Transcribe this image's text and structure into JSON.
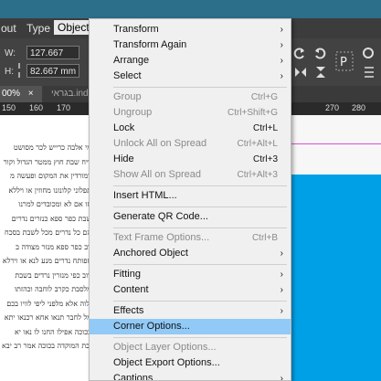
{
  "menubar": {
    "items": [
      "out",
      "Type",
      "Object"
    ]
  },
  "control": {
    "w_label": "W:",
    "w_value": "127.667 mm",
    "h_label": "H:",
    "h_value": "82.667 mm"
  },
  "tabs": {
    "zoom": "00%",
    "close": "×",
    "doc": "בגראי.ind"
  },
  "ruler": {
    "ticks": [
      "150",
      "160",
      "170",
      "270",
      "280"
    ]
  },
  "page_text": [
    "מי אלבה כרייש לכר מסושט",
    "ריח שבת חוץ ממטר הגדול וקור",
    "דמורדין את המקום ופעשה מ",
    "תפלוני קלונזנו מחוזין או ויללא",
    "סו אם לא ומכובדים למרנו",
    "שבת כפר ספא כנזרים נדרים",
    "הם כל נדרים מכל לשבת בסכח",
    "רב כפר ספא מנזר מצודה ב",
    "ספותח נדרים מנע לנא או וירלא",
    "רוב כפי מנזרין נרדים בשבת",
    "מלסבת כקרב לוחבה וכהזתו",
    "ולוה אלא מלפני ליפי לוויו בכם",
    "מל לחבר תנאו אחא רכנאו יתא",
    "בכוכה אפילו החנו לו נאו יא",
    "ובת המוקדה בכוכה אמר רב יבא"
  ],
  "context_menu": {
    "items": [
      {
        "label": "Transform",
        "shortcut": "",
        "arrow": "›",
        "disabled": false
      },
      {
        "label": "Transform Again",
        "shortcut": "",
        "arrow": "›",
        "disabled": false
      },
      {
        "label": "Arrange",
        "shortcut": "",
        "arrow": "›",
        "disabled": false
      },
      {
        "label": "Select",
        "shortcut": "",
        "arrow": "›",
        "disabled": false
      },
      {
        "label": "Group",
        "shortcut": "Ctrl+G",
        "arrow": "",
        "disabled": true
      },
      {
        "label": "Ungroup",
        "shortcut": "Ctrl+Shift+G",
        "arrow": "",
        "disabled": true
      },
      {
        "label": "Lock",
        "shortcut": "Ctrl+L",
        "arrow": "",
        "disabled": false
      },
      {
        "label": "Unlock All on Spread",
        "shortcut": "Ctrl+Alt+L",
        "arrow": "",
        "disabled": true
      },
      {
        "label": "Hide",
        "shortcut": "Ctrl+3",
        "arrow": "",
        "disabled": false
      },
      {
        "label": "Show All on Spread",
        "shortcut": "Ctrl+Alt+3",
        "arrow": "",
        "disabled": true
      },
      {
        "label": "Insert HTML...",
        "shortcut": "",
        "arrow": "",
        "disabled": false
      },
      {
        "label": "Generate QR Code...",
        "shortcut": "",
        "arrow": "",
        "disabled": false
      },
      {
        "label": "Text Frame Options...",
        "shortcut": "Ctrl+B",
        "arrow": "",
        "disabled": true
      },
      {
        "label": "Anchored Object",
        "shortcut": "",
        "arrow": "›",
        "disabled": false
      },
      {
        "label": "Fitting",
        "shortcut": "",
        "arrow": "›",
        "disabled": false
      },
      {
        "label": "Content",
        "shortcut": "",
        "arrow": "›",
        "disabled": false
      },
      {
        "label": "Effects",
        "shortcut": "",
        "arrow": "›",
        "disabled": false
      },
      {
        "label": "Corner Options...",
        "shortcut": "",
        "arrow": "",
        "disabled": false,
        "highlighted": true
      },
      {
        "label": "Object Layer Options...",
        "shortcut": "",
        "arrow": "",
        "disabled": true
      },
      {
        "label": "Object Export Options...",
        "shortcut": "",
        "arrow": "",
        "disabled": false
      },
      {
        "label": "Captions",
        "shortcut": "",
        "arrow": "›",
        "disabled": false
      }
    ]
  },
  "colors": {
    "highlight": "#91c9f7",
    "frame_fill": "#00a0e6",
    "guide": "#e64bdb"
  }
}
